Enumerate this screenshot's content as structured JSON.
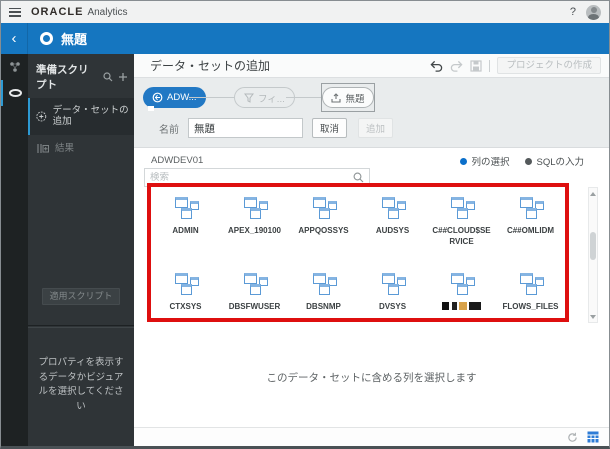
{
  "topbar": {
    "brand": "ORACLE",
    "product": "Analytics",
    "help": "?"
  },
  "titlebar": {
    "back": "‹",
    "title": "無題"
  },
  "sidebar": {
    "panel_title": "準備スクリプト",
    "items": [
      {
        "label": "データ・セットの追加",
        "selected": true
      },
      {
        "label": "結果",
        "selected": false
      }
    ],
    "apply_button": "適用スクリプト",
    "hint": "プロパティを表示するデータかビジュアルを選択してください"
  },
  "main": {
    "title": "データ・セットの追加",
    "create_project_button": "プロジェクトの作成",
    "flow_nodes": [
      {
        "label": "ADW...",
        "type": "connection",
        "selected": false
      },
      {
        "label": "フィ...",
        "type": "filter",
        "selected": false
      },
      {
        "label": "無題",
        "type": "output",
        "selected": true
      }
    ],
    "name_form": {
      "label": "名前",
      "value": "無題",
      "cancel_button": "取消",
      "add_button": "追加"
    },
    "connection_name": "ADWDEV01",
    "view_options": [
      {
        "label": "列の選択",
        "selected": true
      },
      {
        "label": "SQLの入力",
        "selected": false
      }
    ],
    "search_placeholder": "検索",
    "schemas": [
      {
        "label": "ADMIN"
      },
      {
        "label": "APEX_190100"
      },
      {
        "label": "APPQOSSYS"
      },
      {
        "label": "AUDSYS"
      },
      {
        "label": "C##CLOUD$SERVICE"
      },
      {
        "label": "C##OMLIDM"
      },
      {
        "label": "CTXSYS"
      },
      {
        "label": "DBSFWUSER"
      },
      {
        "label": "DBSNMP"
      },
      {
        "label": "DVSYS"
      },
      {
        "label": "",
        "redacted": true
      },
      {
        "label": "FLOWS_FILES"
      }
    ],
    "empty_message": "このデータ・セットに含める列を選択します"
  },
  "colors": {
    "titlebar_blue": "#1576c0",
    "node_blue": "#2178c4",
    "schema_icon_blue": "#5b9ad6",
    "radio_selected_blue": "#0b6fca",
    "annotation_red": "#de0f0f"
  }
}
